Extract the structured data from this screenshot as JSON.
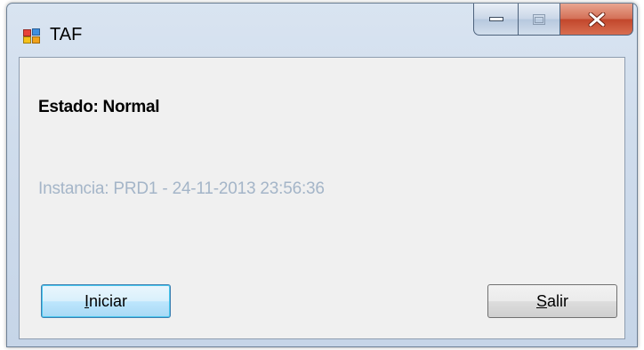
{
  "window": {
    "title": "TAF",
    "icon": "app-window-icon",
    "caption_buttons": [
      "minimize-icon",
      "maximize-icon",
      "close-icon"
    ],
    "colors": {
      "client_bg": "#f0f0f0",
      "close_button": "#c7492e",
      "instancia_text": "#a4b5c8"
    }
  },
  "status": {
    "estado_label": "Estado: Normal",
    "instancia_label": "Instancia: PRD1 - 24-11-2013 23:56:36"
  },
  "buttons": {
    "iniciar": {
      "mnemonic": "I",
      "rest": "niciar"
    },
    "salir": {
      "mnemonic": "S",
      "rest": "alir"
    }
  }
}
